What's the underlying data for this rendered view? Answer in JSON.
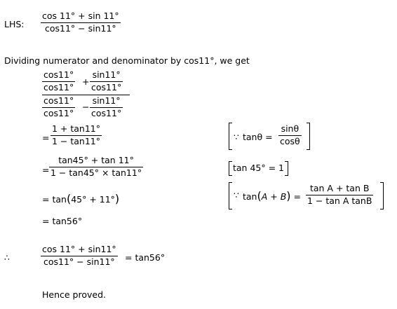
{
  "lhs_label": "LHS:",
  "lhs": {
    "num": "cos 11° + sin 11°",
    "den": "cos11° − sin11°"
  },
  "dividing_text": "Dividing numerator and denominator by  cos11°,  we get",
  "complex": {
    "top_left_num": "cos11°",
    "top_left_den": "cos11°",
    "top_op": "+",
    "top_right_num": "sin11°",
    "top_right_den": "cos11°",
    "bot_left_num": "cos11°",
    "bot_left_den": "cos11°",
    "bot_op": "−",
    "bot_right_num": "sin11°",
    "bot_right_den": "cos11°"
  },
  "step1": {
    "eq": "=",
    "num": "1 + tan11°",
    "den": "1 − tan11°"
  },
  "note1": {
    "because": "∵",
    "lhs": "tanθ =",
    "num": "sinθ",
    "den": "cosθ"
  },
  "step2": {
    "eq": "=",
    "num": "tan45° + tan 11°",
    "den": "1 − tan45° × tan11°"
  },
  "note2": "tan 45° = 1",
  "step3": {
    "text_a": "= tan",
    "text_b": "45° + 11°"
  },
  "note3": {
    "because": "∵",
    "lhs_a": "tan",
    "lhs_b": "A + B",
    "eq": "=",
    "num": "tan A + tan B",
    "den": "1 − tan A tanB"
  },
  "step4": "= tan56°",
  "therefore": "∴",
  "final": {
    "num": "cos 11° + sin11°",
    "den": "cos11° − sin11°",
    "rhs": "= tan56°"
  },
  "proved": "Hence proved."
}
